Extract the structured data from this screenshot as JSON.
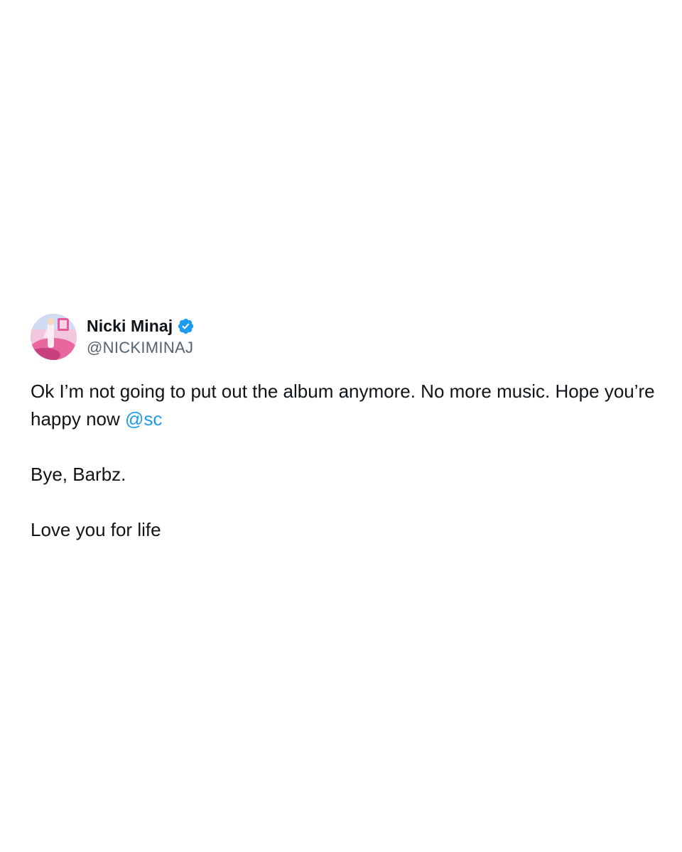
{
  "tweet": {
    "author": {
      "display_name": "Nicki Minaj",
      "handle": "@NICKIMINAJ",
      "verified": true,
      "verified_icon": "verified-badge-icon",
      "avatar": "profile-avatar"
    },
    "text": {
      "line1_before": "Ok I’m not going to put out the album anymore. No more music. Hope you’re happy now ",
      "mention": "@sc",
      "para2": "Bye, Barbz.",
      "para3": "Love you for life"
    },
    "colors": {
      "text": "#0f1419",
      "secondary": "#536471",
      "link": "#1d9bf0",
      "verified": "#1d9bf0",
      "background": "#ffffff"
    }
  }
}
